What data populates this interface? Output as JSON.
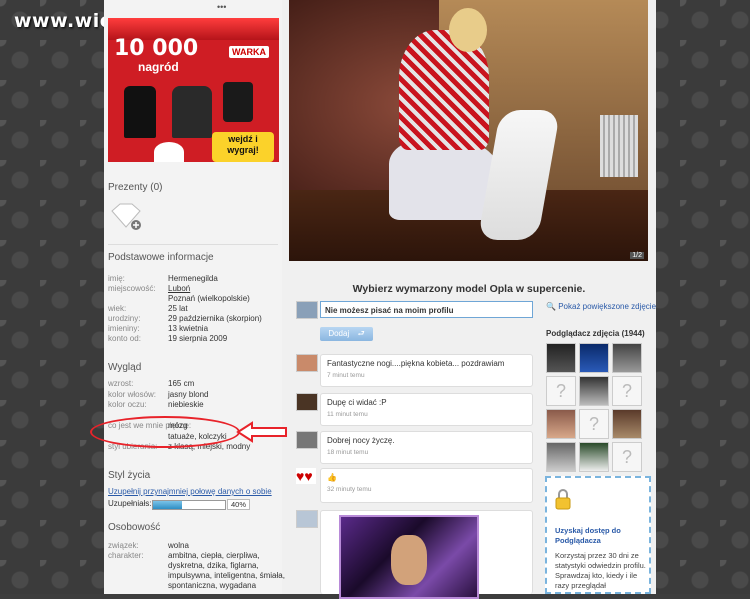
{
  "watermark": "www.wiocha.pl",
  "ad": {
    "prize": "10 000",
    "prize_label": "nagród",
    "brand": "WARKA",
    "cta": "wejdź i wygraj!"
  },
  "left": {
    "gifts_title": "Prezenty (0)",
    "basic_title": "Podstawowe informacje",
    "basic": [
      {
        "k": "imię:",
        "v": "Hermenegilda"
      },
      {
        "k": "miejscowość:",
        "v": "Luboń",
        "link": true
      },
      {
        "k": "",
        "v": "Poznań (wielkopolskie)"
      },
      {
        "k": "wiek:",
        "v": "25 lat"
      },
      {
        "k": "urodziny:",
        "v": "29 października (skorpion)"
      },
      {
        "k": "imieniny:",
        "v": "13 kwietnia"
      },
      {
        "k": "konto od:",
        "v": "19 sierpnia 2009"
      }
    ],
    "look_title": "Wygląd",
    "look": [
      {
        "k": "wzrost:",
        "v": "165 cm"
      },
      {
        "k": "kolor włosów:",
        "v": "jasny blond"
      },
      {
        "k": "kolor oczu:",
        "v": "niebieskie"
      },
      {
        "k": "",
        "v": ""
      },
      {
        "k": "co jest we mnie piękne:",
        "v": "mózg"
      },
      {
        "k": "",
        "v": "tatuaże, kolczyki"
      },
      {
        "k": "styl ubierania:",
        "v": "z klasą, miejski, modny"
      }
    ],
    "life_title": "Styl życia",
    "life_link": "Uzupełnij przynajmniej połowę danych o sobie",
    "fill_label": "Uzupełniałs:",
    "fill_percent": 40,
    "fill_text": "40%",
    "person_title": "Osobowość",
    "person": [
      {
        "k": "związek:",
        "v": "wolna"
      },
      {
        "k": "charakter:",
        "v": "ambitna, ciepła, cierpliwa, dyskretna, dzika, figlarna, impulsywna, inteligentna, śmiała, spontaniczna, wygadana"
      }
    ]
  },
  "photo": {
    "badge": "1/2"
  },
  "opel_text": "Wybierz wymarzony model Opla w supercenie.",
  "comment_box": {
    "placeholder": "Nie możesz pisać na moim profilu",
    "button": "Dodaj"
  },
  "comments": [
    {
      "text": "Fantastyczne nogi....piękna kobieta... pozdrawiam",
      "date": "7 minut temu"
    },
    {
      "text": "Dupę ci widać :P",
      "date": "11 minut temu"
    },
    {
      "text": "Dobrej nocy życzę.",
      "date": "18 minut temu"
    },
    {
      "text": "👍",
      "date": "32 minuty temu"
    }
  ],
  "right": {
    "zoom_link": "Pokaż powiększone zdjęcie",
    "viewers_title": "Podglądacz zdjęcia (1944)",
    "promo_title": "Uzyskaj dostęp do Podglądacza",
    "promo_body": "Korzystaj przez 30 dni ze statystyki odwiedzin profilu. Sprawdzaj kto, kiedy i ile razy przeglądał"
  },
  "colors": {
    "accent": "#2a5aa8",
    "highlight": "#e8232a",
    "ad_red": "#cf1d24"
  }
}
